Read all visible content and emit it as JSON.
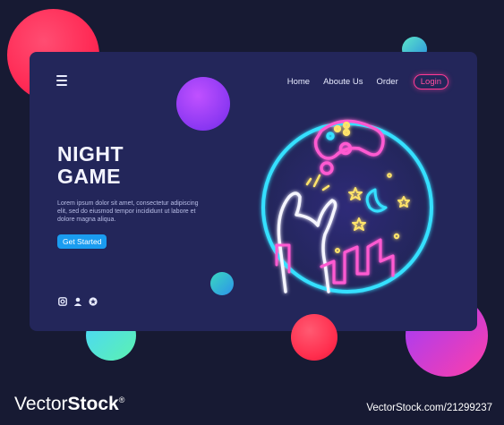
{
  "nav": {
    "menu_icon": "hamburger-icon",
    "items": [
      "Home",
      "Aboute Us",
      "Order"
    ],
    "login_label": "Login"
  },
  "hero": {
    "title_line1": "NIGHT",
    "title_line2": "GAME",
    "description": "Lorem ipsum dolor sit amet, consectetur adipiscing elit, sed do eiusmod tempor incididunt ut labore et dolore magna aliqua.",
    "cta_label": "Get Started"
  },
  "social_icons": [
    "instagram-icon",
    "user-icon",
    "star-icon"
  ],
  "colors": {
    "background": "#171a33",
    "panel": "#23265a",
    "accent_blue": "#1a9cf0",
    "neon_pink": "#ff3a94",
    "neon_cyan": "#36e0ff"
  },
  "watermark": {
    "brand_light": "Vector",
    "brand_bold": "Stock",
    "registered": "®",
    "id_text": "VectorStock.com/21299237"
  }
}
